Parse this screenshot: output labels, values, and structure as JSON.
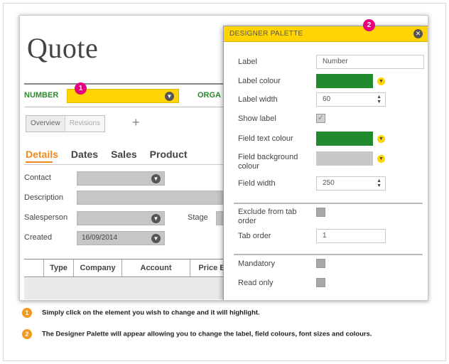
{
  "quote": {
    "title": "Quote",
    "number_label": "NUMBER",
    "organisation_label": "ORGA",
    "badge_1": "1",
    "section_buttons": [
      "Overview",
      "Revisions"
    ],
    "add_label": "+",
    "tabs": [
      "Details",
      "Dates",
      "Sales",
      "Product"
    ],
    "fields": {
      "contact_label": "Contact",
      "description_label": "Description",
      "salesperson_label": "Salesperson",
      "stage_label": "Stage",
      "created_label": "Created",
      "created_value": "16/09/2014"
    },
    "table_columns": [
      "Type",
      "Company",
      "Account",
      "Price E"
    ]
  },
  "palette": {
    "title": "DESIGNER PALETTE",
    "badge_2": "2",
    "label_label": "Label",
    "label_value": "Number",
    "label_colour_label": "Label colour",
    "label_colour": "#218a2e",
    "label_width_label": "Label width",
    "label_width_value": "60",
    "show_label_label": "Show label",
    "show_label_checked": true,
    "field_text_colour_label": "Field text colour",
    "field_text_colour": "#218a2e",
    "field_bg_colour_label": "Field background colour",
    "field_bg_colour": "#c8c8c8",
    "field_width_label": "Field width",
    "field_width_value": "250",
    "exclude_tab_label": "Exclude from tab order",
    "tab_order_label": "Tab order",
    "tab_order_value": "1",
    "mandatory_label": "Mandatory",
    "read_only_label": "Read only"
  },
  "notes": [
    {
      "num": "1",
      "text": "Simply click on the element you wish to change and it will highlight."
    },
    {
      "num": "2",
      "text": "The Designer Palette will appear allowing you to change the label, field colours, font sizes and colours."
    }
  ],
  "colors": {
    "highlight": "#ffd400",
    "accent_green": "#2a8a2a",
    "tab_active": "#f08a1c",
    "badge_pink": "#e6007e",
    "note_orange": "#f39a1e"
  }
}
